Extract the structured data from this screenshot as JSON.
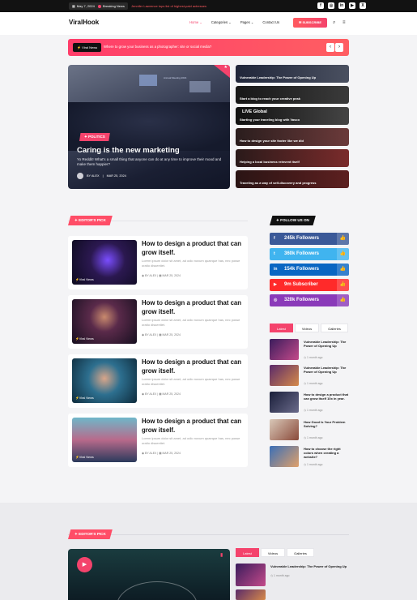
{
  "topbar": {
    "date": "May 7, 2024",
    "breaking": "Breaking News",
    "ticker": "Jennifer Lawrence tops list of highest-paid actresses",
    "socials": [
      "f",
      "◎",
      "in",
      "▶",
      "X"
    ]
  },
  "header": {
    "logo": "ViralHook",
    "nav": [
      "Home",
      "Categories",
      "Pages",
      "Contact Us"
    ],
    "subscribe": "SUBSCRIBE"
  },
  "promo": {
    "label": "Viral News",
    "text": "Where to grow your business as a photographer: site or social media?"
  },
  "hero": {
    "category": "POLITICS",
    "title": "Caring is the new marketing",
    "desc": "Yo Reddit! What's a small thing that anyone can do at any time to improve their mood and make them happier?",
    "author": "BY ALEX",
    "date": "MAR 25, 2024",
    "stage_text": "Annual Meeting 2016"
  },
  "side_posts": [
    {
      "title": "Vulnerable Leadership: The Power of Opening Up"
    },
    {
      "title": "Start a blog to reach your creative peak"
    },
    {
      "title": "Starting your traveling blog with Vasco"
    },
    {
      "title": "How to design your site footer like we did"
    },
    {
      "title": "Helping a local business reinvent itself"
    },
    {
      "title": "Traveling as a way of self-discovery and progress"
    }
  ],
  "live_text": "LIVE Global",
  "editors": {
    "label": "EDITOR'S PICK",
    "cards": [
      {
        "title": "How to design a product that can grow itself.",
        "excerpt": "Lorem ipsum dolor sit amet, ad odio novum quaeque has, nec posse oratio dissentiet.",
        "meta": "BY ALEX",
        "date": "MAR 25, 2024",
        "tag": "Viral News"
      },
      {
        "title": "How to design a product that can grow itself.",
        "excerpt": "Lorem ipsum dolor sit amet, ad odio novum quaeque has, nec posse oratio dissentiet.",
        "meta": "BY ALEX",
        "date": "MAR 25, 2024",
        "tag": "Viral News"
      },
      {
        "title": "How to design a product that can grow itself.",
        "excerpt": "Lorem ipsum dolor sit amet, ad odio novum quaeque has, nec posse oratio dissentiet.",
        "meta": "BY ALEX",
        "date": "MAR 25, 2024",
        "tag": "Viral News"
      },
      {
        "title": "How to design a product that can grow itself.",
        "excerpt": "Lorem ipsum dolor sit amet, ad odio novum quaeque has, nec posse oratio dissentiet.",
        "meta": "BY ALEX",
        "date": "MAR 25, 2024",
        "tag": "Viral News"
      }
    ]
  },
  "follow": {
    "label": "FOLLOW US ON",
    "items": [
      {
        "icon": "f",
        "text": "245k Followers",
        "color": "#3b5998"
      },
      {
        "icon": "t",
        "text": "360k Followers",
        "color": "#40b4ef"
      },
      {
        "icon": "in",
        "text": "154k Followers",
        "color": "#0a66c2"
      },
      {
        "icon": "▶",
        "text": "9m Subscriber",
        "color": "#ff2a2a"
      },
      {
        "icon": "◎",
        "text": "320k Followers",
        "color": "#8a3ab9"
      }
    ]
  },
  "tabs": [
    "Latest",
    "Videos",
    "Galleries"
  ],
  "mini_posts": [
    {
      "title": "Vulnerable Leadership: The Power of Opening Up",
      "date": "1 month ago"
    },
    {
      "title": "Vulnerable Leadership: The Power of Opening Up",
      "date": "1 month ago"
    },
    {
      "title": "How to design a product that can grow itself 10x in year.",
      "date": "1 month ago"
    },
    {
      "title": "How Good Is Your Problem Solving?",
      "date": "1 month ago"
    },
    {
      "title": "How to choose the right colors when creating a website?",
      "date": "1 month ago"
    }
  ],
  "bottom": {
    "label": "EDITOR'S PICK",
    "tabs": [
      "Latest",
      "Videos",
      "Galleries"
    ],
    "post_title": "Vulnerable Leadership: The Power of Opening Up",
    "post_date": "1 month ago"
  }
}
